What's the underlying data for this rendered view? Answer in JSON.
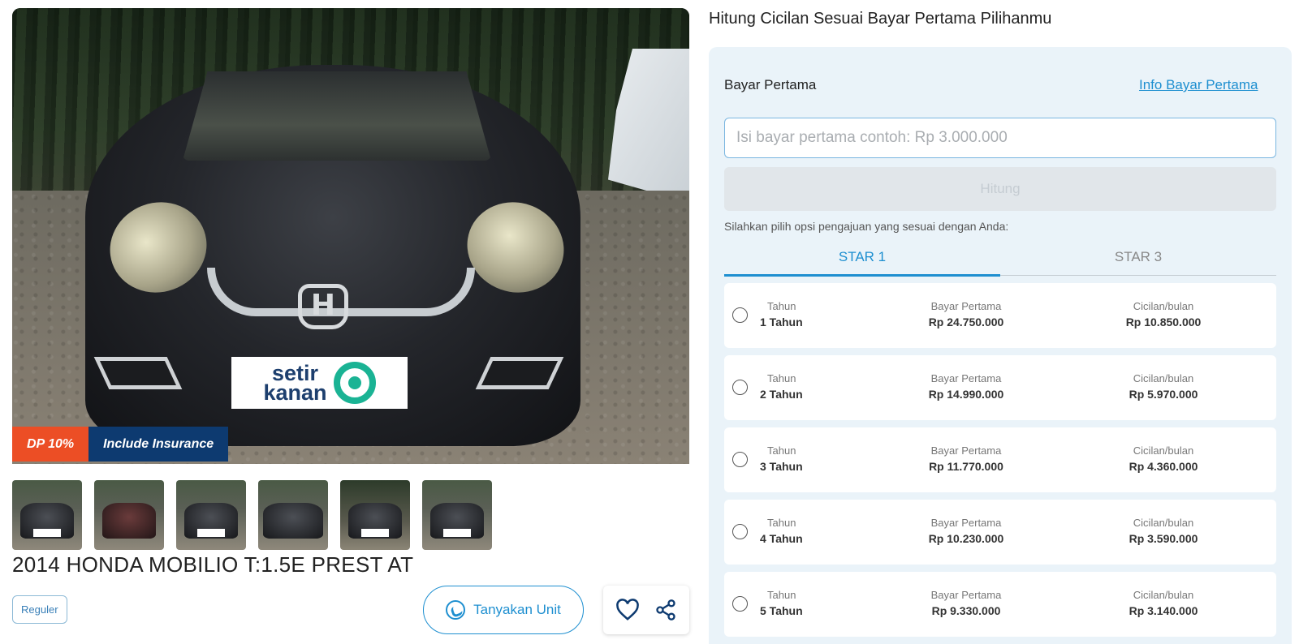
{
  "listing": {
    "badge_dp": "DP 10%",
    "badge_insurance": "Include Insurance",
    "plate_logo_text": "setir kanan",
    "title": "2014 HONDA MOBILIO T:1.5E PREST AT",
    "tag": "Reguler",
    "ask_button": "Tanyakan Unit",
    "thumbnail_count": 6
  },
  "calculator": {
    "heading": "Hitung Cicilan Sesuai Bayar Pertama Pilihanmu",
    "bp_label": "Bayar Pertama",
    "bp_info_link": "Info Bayar Pertama",
    "input_placeholder": "Isi bayar pertama contoh: Rp 3.000.000",
    "input_value": "",
    "calc_button": "Hitung",
    "hint": "Silahkan pilih opsi pengajuan yang sesuai dengan Anda:",
    "tabs": [
      {
        "label": "STAR 1",
        "active": true
      },
      {
        "label": "STAR 3",
        "active": false
      }
    ],
    "options": [
      {
        "tenor_label": "Tahun",
        "tenor": "1 Tahun",
        "dp_label": "Bayar Pertama",
        "dp": "Rp 24.750.000",
        "inst_label": "Cicilan/bulan",
        "inst": "Rp 10.850.000"
      },
      {
        "tenor_label": "Tahun",
        "tenor": "2 Tahun",
        "dp_label": "Bayar Pertama",
        "dp": "Rp 14.990.000",
        "inst_label": "Cicilan/bulan",
        "inst": "Rp 5.970.000"
      },
      {
        "tenor_label": "Tahun",
        "tenor": "3 Tahun",
        "dp_label": "Bayar Pertama",
        "dp": "Rp 11.770.000",
        "inst_label": "Cicilan/bulan",
        "inst": "Rp 4.360.000"
      },
      {
        "tenor_label": "Tahun",
        "tenor": "4 Tahun",
        "dp_label": "Bayar Pertama",
        "dp": "Rp 10.230.000",
        "inst_label": "Cicilan/bulan",
        "inst": "Rp 3.590.000"
      },
      {
        "tenor_label": "Tahun",
        "tenor": "5 Tahun",
        "dp_label": "Bayar Pertama",
        "dp": "Rp 9.330.000",
        "inst_label": "Cicilan/bulan",
        "inst": "Rp 3.140.000"
      }
    ]
  },
  "colors": {
    "accent": "#1e8fd0",
    "badge_dp": "#ec4e25",
    "badge_insurance": "#0d3a70",
    "panel_bg": "#eaf3f9"
  },
  "icons": {
    "ask": "whatsapp-icon",
    "favorite": "heart-icon",
    "share": "share-icon"
  }
}
